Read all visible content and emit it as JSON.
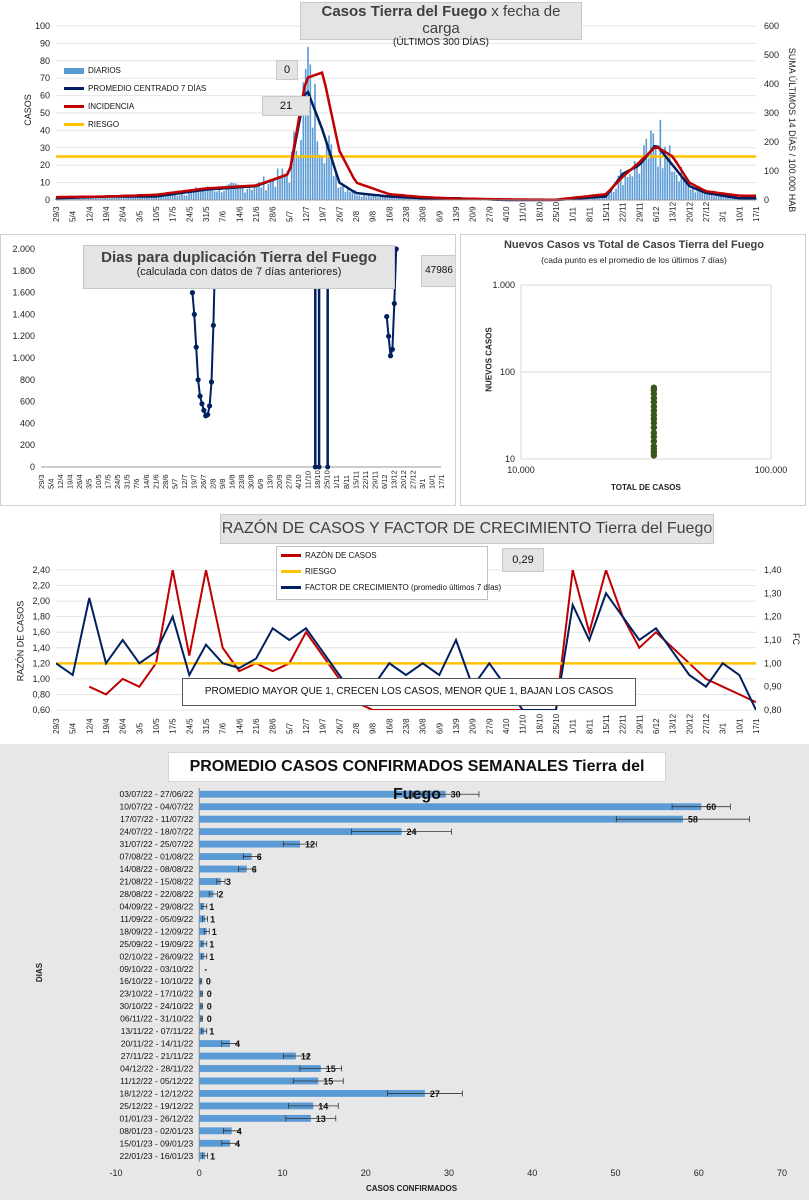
{
  "panel1": {
    "title_bold": "Casos Tierra del Fuego",
    "title_rest": " x fecha de carga",
    "subtitle": "(ÚLTIMOS 300 DÍAS)",
    "ylabel_left": "CASOS",
    "ylabel_right": "SUMA ÚLTIMOS 14 DÍAS / 100.000 HAB",
    "value_box_1": "0",
    "value_box_2": "21",
    "legend": [
      "DIARIOS",
      "PROMEDIO CENTRADO 7 DÍAS",
      "INCIDENCIA",
      "RIESGO"
    ]
  },
  "panel2": {
    "title": "Dias para duplicación Tierra del Fuego",
    "subtitle": "(calculada con datos de 7 días anteriores)",
    "value_box": "47986"
  },
  "panel3": {
    "title": "Nuevos Casos vs Total de Casos Tierra del Fuego",
    "subtitle": "(cada punto es el promedio de los últimos 7 días)",
    "ylabel": "NUEVOS CASOS",
    "xlabel": "TOTAL DE CASOS"
  },
  "panel4": {
    "title_bold": "RAZÓN DE CASOS Y FACTOR DE CRECIMIENTO",
    "title_rest": " Tierra del Fuego",
    "value_box": "0,29",
    "ylabel_left": "RAZÓN DE CASOS",
    "ylabel_right": "FC",
    "legend": [
      "RAZÓN DE CASOS",
      "RIESGO",
      "FACTOR DE CRECIMIENTO (promedio últimos 7 días)"
    ],
    "note": "PROMEDIO MAYOR QUE 1, CRECEN LOS CASOS, MENOR QUE 1, BAJAN LOS CASOS"
  },
  "panel5": {
    "title": "PROMEDIO CASOS CONFIRMADOS SEMANALES Tierra del Fuego",
    "ylabel": "DIAS",
    "xlabel": "CASOS CONFIRMADOS"
  },
  "colors": {
    "daily": "#5b9bd5",
    "avg": "#002060",
    "incidence": "#c00000",
    "risk": "#ffc000",
    "scatter": "#38571a",
    "bar": "#5b9bd5"
  },
  "chart_data": [
    {
      "id": "casos",
      "type": "line",
      "title": "Casos Tierra del Fuego x fecha de carga",
      "x_ticks": [
        "29/3",
        "5/4",
        "12/4",
        "19/4",
        "26/4",
        "3/5",
        "10/5",
        "17/5",
        "24/5",
        "31/5",
        "7/6",
        "14/6",
        "21/6",
        "28/6",
        "5/7",
        "12/7",
        "19/7",
        "26/7",
        "2/8",
        "9/8",
        "16/8",
        "23/8",
        "30/8",
        "6/9",
        "13/9",
        "20/9",
        "27/9",
        "4/10",
        "11/10",
        "18/10",
        "25/10",
        "1/11",
        "8/11",
        "15/11",
        "22/11",
        "29/11",
        "6/12",
        "13/12",
        "20/12",
        "27/12",
        "3/1",
        "10/1",
        "17/1"
      ],
      "ylim": [
        0,
        100
      ],
      "y_ticks": [
        0,
        10,
        20,
        30,
        40,
        50,
        60,
        70,
        80,
        90,
        100
      ],
      "y2lim": [
        0,
        600
      ],
      "y2_ticks": [
        0,
        100,
        200,
        300,
        400,
        500,
        600
      ],
      "series": [
        {
          "name": "PROMEDIO CENTRADO 7 DÍAS",
          "axis": "left",
          "x_idx": [
            0,
            3,
            6,
            9,
            12,
            14,
            15,
            16,
            17,
            18,
            20,
            22,
            24,
            27,
            30,
            33,
            34,
            35,
            36,
            37,
            38,
            39,
            41,
            42
          ],
          "values": [
            1,
            2,
            2,
            6,
            8,
            15,
            65,
            40,
            10,
            4,
            2,
            1,
            1,
            0,
            0,
            2,
            15,
            20,
            32,
            20,
            8,
            4,
            1,
            1
          ]
        },
        {
          "name": "INCIDENCIA",
          "axis": "right",
          "x_idx": [
            0,
            3,
            6,
            9,
            12,
            14,
            15,
            16,
            17,
            18,
            20,
            22,
            24,
            27,
            30,
            33,
            34,
            35,
            36,
            37,
            38,
            39,
            41,
            42
          ],
          "values": [
            10,
            12,
            18,
            40,
            50,
            90,
            420,
            440,
            170,
            60,
            20,
            10,
            5,
            2,
            1,
            20,
            80,
            130,
            185,
            150,
            60,
            30,
            15,
            15
          ]
        },
        {
          "name": "RIESGO",
          "axis": "left",
          "x_idx": [
            0,
            42
          ],
          "values": [
            25,
            25
          ]
        }
      ],
      "daily_peaks": {
        "x_idx": [
          15.1,
          36.3
        ],
        "values": [
          88,
          46
        ]
      }
    },
    {
      "id": "duplicacion",
      "type": "line",
      "title": "Dias para duplicación Tierra del Fuego",
      "ylim": [
        0,
        2000
      ],
      "y_ticks": [
        0,
        200,
        400,
        600,
        800,
        1000,
        1200,
        1400,
        1600,
        1800,
        2000
      ],
      "x_ticks": [
        "29/3",
        "5/4",
        "12/4",
        "19/4",
        "26/4",
        "3/5",
        "10/5",
        "17/5",
        "24/5",
        "31/5",
        "7/6",
        "14/6",
        "21/6",
        "28/6",
        "5/7",
        "12/7",
        "19/7",
        "26/7",
        "2/8",
        "9/8",
        "16/8",
        "23/8",
        "30/8",
        "6/9",
        "13/9",
        "20/9",
        "27/9",
        "4/10",
        "11/10",
        "18/10",
        "25/10",
        "1/11",
        "8/11",
        "15/11",
        "22/11",
        "29/11",
        "6/12",
        "13/12",
        "20/12",
        "27/12",
        "3/1",
        "10/1",
        "17/1"
      ],
      "series": [
        {
          "name": "Dias para duplicación",
          "x_idx": [
            15.9,
            16.1,
            16.3,
            16.5,
            16.7,
            16.9,
            17.1,
            17.3,
            17.5,
            17.7,
            17.9,
            18.1,
            18.3
          ],
          "values": [
            1600,
            1400,
            1100,
            800,
            650,
            580,
            520,
            470,
            480,
            560,
            780,
            1300,
            2000
          ]
        },
        {
          "name": "Dias para duplicación (tramo 2)",
          "x_idx": [
            36.3,
            36.5,
            36.7,
            36.9,
            37.1,
            37.3
          ],
          "values": [
            1380,
            1200,
            1020,
            1080,
            1500,
            2000
          ]
        }
      ]
    },
    {
      "id": "nuevos_vs_total",
      "type": "scatter",
      "title": "Nuevos Casos vs Total de Casos Tierra del Fuego",
      "xlim": [
        10000,
        100000
      ],
      "x_ticks": [
        "10.000",
        "100.000"
      ],
      "ylim": [
        10,
        1000
      ],
      "y_ticks": [
        "10",
        "100",
        "1.000"
      ],
      "x_scale": "log",
      "y_scale": "log",
      "points_x": 34000,
      "points_y": [
        11,
        12,
        13,
        14,
        16,
        18,
        20,
        23,
        26,
        29,
        32,
        36,
        40,
        45,
        50,
        56,
        62,
        66
      ]
    },
    {
      "id": "razon_fc",
      "type": "line",
      "title": "RAZÓN DE CASOS Y FACTOR DE CRECIMIENTO Tierra del Fuego",
      "ylim": [
        0.6,
        2.4
      ],
      "y_ticks": [
        "0,60",
        "0,80",
        "1,00",
        "1,20",
        "1,40",
        "1,60",
        "1,80",
        "2,00",
        "2,20",
        "2,40"
      ],
      "y2lim": [
        0.8,
        1.4
      ],
      "y2_ticks": [
        "0,80",
        "0,90",
        "1,00",
        "1,10",
        "1,20",
        "1,30",
        "1,40"
      ],
      "x_ticks": [
        "29/3",
        "5/4",
        "12/4",
        "19/4",
        "26/4",
        "3/5",
        "10/5",
        "17/5",
        "24/5",
        "31/5",
        "7/6",
        "14/6",
        "21/6",
        "28/6",
        "5/7",
        "12/7",
        "19/7",
        "26/7",
        "2/8",
        "9/8",
        "16/8",
        "23/8",
        "30/8",
        "6/9",
        "13/9",
        "20/9",
        "27/9",
        "4/10",
        "11/10",
        "18/10",
        "25/10",
        "1/11",
        "8/11",
        "15/11",
        "22/11",
        "29/11",
        "6/12",
        "13/12",
        "20/12",
        "27/12",
        "3/1",
        "10/1",
        "17/1"
      ],
      "series": [
        {
          "name": "FACTOR DE CRECIMIENTO (promedio últimos 7 días)",
          "axis": "right",
          "x_idx": [
            0,
            1,
            2,
            3,
            4,
            5,
            6,
            7,
            8,
            9,
            10,
            11,
            12,
            13,
            14,
            15,
            16,
            17,
            18,
            19,
            20,
            21,
            22,
            23,
            24,
            25,
            26,
            27,
            28,
            29,
            30,
            31,
            32,
            33,
            34,
            35,
            36,
            37,
            38,
            39,
            40,
            41,
            42
          ],
          "values": [
            1.0,
            0.95,
            1.28,
            1.0,
            1.1,
            1.0,
            1.05,
            1.2,
            0.95,
            1.08,
            1.0,
            0.98,
            1.02,
            1.15,
            1.1,
            1.15,
            1.05,
            0.95,
            0.85,
            0.9,
            1.0,
            0.95,
            1.0,
            0.95,
            1.1,
            0.9,
            1.0,
            0.9,
            0.8,
            0.8,
            0.8,
            1.25,
            1.1,
            1.3,
            1.2,
            1.1,
            1.15,
            1.05,
            0.95,
            0.9,
            1.0,
            0.95,
            0.8
          ]
        },
        {
          "name": "RAZÓN DE CASOS",
          "axis": "left",
          "x_idx": [
            2,
            3,
            4,
            5,
            6,
            7,
            8,
            9,
            10,
            11,
            12,
            13,
            14,
            15,
            16,
            17,
            18,
            19,
            20,
            21,
            22,
            23,
            24,
            25,
            26,
            27,
            28,
            29,
            30,
            31,
            32,
            33,
            34,
            35,
            36,
            37,
            38,
            39,
            40,
            41,
            42
          ],
          "values": [
            0.9,
            0.8,
            1.0,
            0.9,
            1.2,
            2.4,
            1.3,
            2.4,
            1.4,
            1.1,
            1.2,
            1.1,
            1.2,
            1.6,
            1.3,
            1.0,
            0.7,
            0.6,
            0.6,
            0.6,
            0.6,
            0.6,
            0.6,
            0.6,
            0.6,
            0.6,
            0.6,
            0.6,
            0.6,
            2.4,
            1.6,
            2.4,
            1.8,
            1.4,
            1.6,
            1.4,
            1.2,
            1.0,
            0.9,
            0.8,
            0.7
          ]
        },
        {
          "name": "RIESGO",
          "axis": "right",
          "x_idx": [
            0,
            42
          ],
          "values": [
            1.0,
            1.0
          ]
        }
      ]
    },
    {
      "id": "semanales",
      "type": "bar",
      "orientation": "horizontal",
      "title": "PROMEDIO CASOS CONFIRMADOS SEMANALES Tierra del Fuego",
      "xlabel": "CASOS CONFIRMADOS",
      "ylabel": "DIAS",
      "xlim": [
        -10,
        70
      ],
      "x_ticks": [
        -10,
        0,
        10,
        20,
        30,
        40,
        50,
        60,
        70
      ],
      "categories": [
        "03/07/22 - 27/06/22",
        "10/07/22 - 04/07/22",
        "17/07/22 - 11/07/22",
        "24/07/22 - 18/07/22",
        "31/07/22 - 25/07/22",
        "07/08/22 - 01/08/22",
        "14/08/22 - 08/08/22",
        "21/08/22 - 15/08/22",
        "28/08/22 - 22/08/22",
        "04/09/22 - 29/08/22",
        "11/09/22 - 05/09/22",
        "18/09/22 - 12/09/22",
        "25/09/22 - 19/09/22",
        "02/10/22 - 26/09/22",
        "09/10/22 - 03/10/22",
        "16/10/22 - 10/10/22",
        "23/10/22 - 17/10/22",
        "30/10/22 - 24/10/22",
        "06/11/22 - 31/10/22",
        "13/11/22 - 07/11/22",
        "20/11/22 - 14/11/22",
        "27/11/22 - 21/11/22",
        "04/12/22 - 28/11/22",
        "11/12/22 - 05/12/22",
        "18/12/22 - 12/12/22",
        "25/12/22 - 19/12/22",
        "01/01/23 - 26/12/22",
        "08/01/23 - 02/01/23",
        "15/01/23 - 09/01/23",
        "22/01/23 - 16/01/23"
      ],
      "values": [
        29.6,
        60.3,
        58.1,
        24.3,
        12.1,
        6.3,
        5.7,
        2.6,
        1.7,
        0.6,
        0.7,
        0.9,
        0.6,
        0.6,
        0,
        0.2,
        0.3,
        0.3,
        0.3,
        0.6,
        3.7,
        11.6,
        14.6,
        14.3,
        27.1,
        13.7,
        13.4,
        3.9,
        3.7,
        0.7
      ],
      "data_labels": [
        "30",
        "60",
        "58",
        "24",
        "12",
        "6",
        "6",
        "3",
        "2",
        "1",
        "1",
        "1",
        "1",
        "1",
        "-",
        "0",
        "0",
        "0",
        "0",
        "1",
        "4",
        "12",
        "15",
        "15",
        "27",
        "14",
        "13",
        "4",
        "4",
        "1"
      ],
      "errors": [
        4,
        3.5,
        8,
        6,
        2,
        1,
        1,
        0.5,
        0.5,
        0.3,
        0.3,
        0.3,
        0.3,
        0.3,
        0,
        0.1,
        0.1,
        0.1,
        0.1,
        0.3,
        1,
        1.5,
        2.5,
        3,
        4.5,
        3,
        3,
        1,
        1,
        0.3
      ]
    }
  ]
}
